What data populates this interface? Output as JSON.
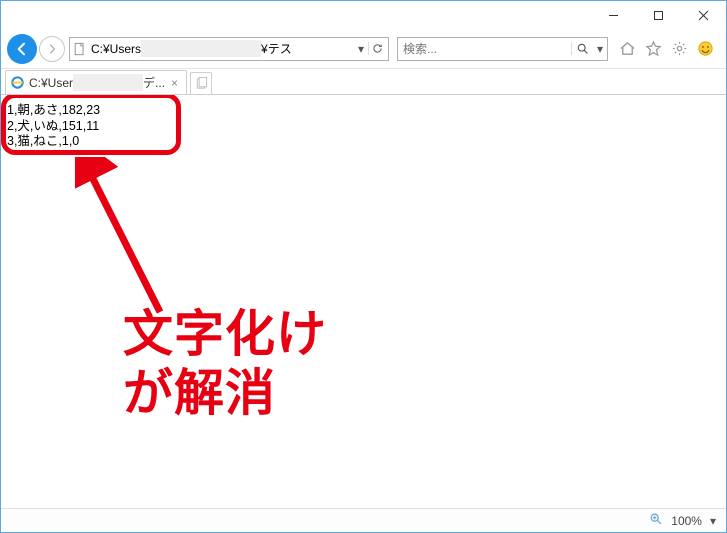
{
  "window": {
    "controls": {
      "minimize": "–",
      "maximize": "□",
      "close": "×"
    }
  },
  "toolbar": {
    "address_prefix": "C:¥Users",
    "address_suffix": "¥テス",
    "search_placeholder": "検索..."
  },
  "tabs": {
    "active_prefix": "C:¥User",
    "active_suffix": "デ..."
  },
  "content": {
    "lines": [
      "1,朝,あさ,182,23",
      "2,犬,いぬ,151,11",
      "3,猫,ねこ,1,0"
    ]
  },
  "annotation": {
    "line1": "文字化け",
    "line2": "が解消"
  },
  "statusbar": {
    "zoom": "100%"
  }
}
